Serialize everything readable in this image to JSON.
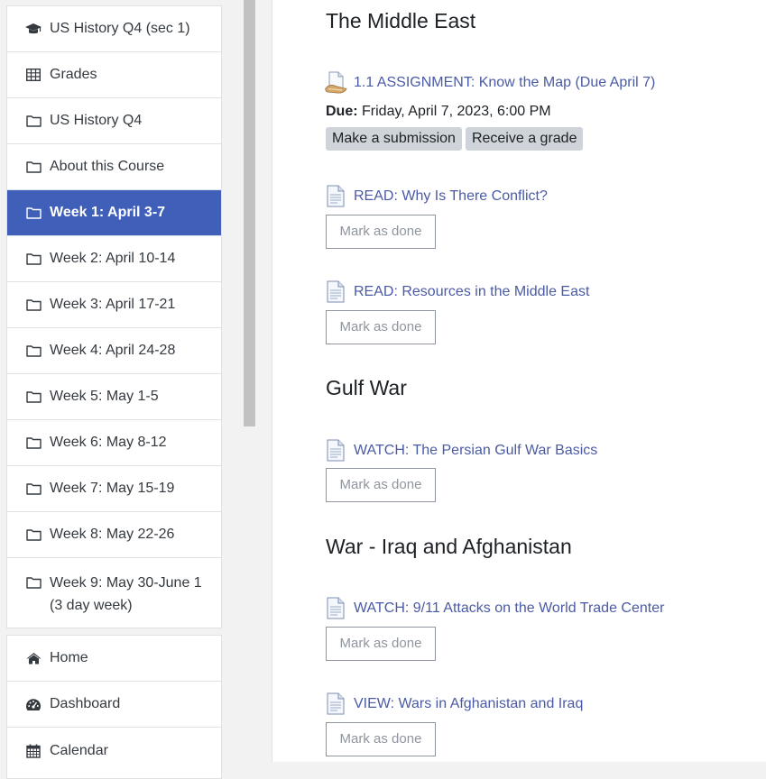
{
  "sidebar": {
    "course_nav": [
      {
        "icon": "graduation-cap-icon",
        "label": "US History Q4 (sec 1)"
      },
      {
        "icon": "table-icon",
        "label": "Grades"
      },
      {
        "icon": "folder-icon",
        "label": "US History Q4"
      },
      {
        "icon": "folder-icon",
        "label": "About this Course"
      },
      {
        "icon": "folder-icon",
        "label": "Week 1: April 3-7",
        "active": true
      },
      {
        "icon": "folder-icon",
        "label": "Week 2: April 10-14"
      },
      {
        "icon": "folder-icon",
        "label": "Week 3: April 17-21"
      },
      {
        "icon": "folder-icon",
        "label": "Week 4: April 24-28"
      },
      {
        "icon": "folder-icon",
        "label": "Week 5: May 1-5"
      },
      {
        "icon": "folder-icon",
        "label": "Week 6: May 8-12"
      },
      {
        "icon": "folder-icon",
        "label": "Week 7: May 15-19"
      },
      {
        "icon": "folder-icon",
        "label": "Week 8: May 22-26"
      },
      {
        "icon": "folder-icon",
        "label": "Week 9: May 30-June 1 (3 day week)"
      }
    ],
    "site_nav": [
      {
        "icon": "home-icon",
        "label": "Home"
      },
      {
        "icon": "dashboard-icon",
        "label": "Dashboard"
      },
      {
        "icon": "calendar-icon",
        "label": "Calendar"
      }
    ]
  },
  "main": {
    "sections": [
      {
        "title": "The Middle East"
      },
      {
        "title": "Gulf War"
      },
      {
        "title": "War - Iraq and Afghanistan"
      }
    ],
    "assignment": {
      "icon": "assignment-icon",
      "link": "1.1 ASSIGNMENT: Know the Map (Due April 7)",
      "due_label": "Due:",
      "due_value": " Friday, April 7, 2023, 6:00 PM",
      "badges": [
        "Make a submission",
        "Receive a grade"
      ]
    },
    "resources": [
      {
        "icon": "page-icon",
        "link": "READ: Why Is There Conflict?",
        "button": "Mark as done"
      },
      {
        "icon": "page-icon",
        "link": "READ: Resources in the Middle East",
        "button": "Mark as done"
      },
      {
        "icon": "page-icon",
        "link": "WATCH: The Persian Gulf War Basics",
        "button": "Mark as done"
      },
      {
        "icon": "page-icon",
        "link": "WATCH: 9/11 Attacks on the World Trade Center",
        "button": "Mark as done"
      },
      {
        "icon": "page-icon",
        "link": "VIEW: Wars in Afghanistan and Iraq",
        "button": "Mark as done"
      }
    ]
  }
}
